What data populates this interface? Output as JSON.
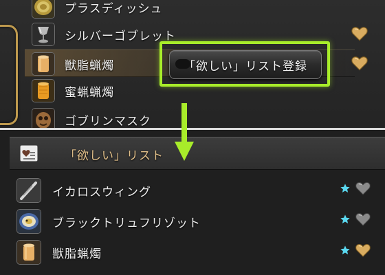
{
  "item_list": [
    {
      "name": "プラスディッシュ",
      "icon": "plate-icon",
      "heart": "none",
      "selected": false
    },
    {
      "name": "シルバーゴブレット",
      "icon": "goblet-icon",
      "heart": "gold",
      "selected": false
    },
    {
      "name": "獣脂蝋燭",
      "icon": "candle-icon",
      "heart": "gold",
      "selected": true
    },
    {
      "name": "蜜蝋蝋燭",
      "icon": "beeswax-candle-icon",
      "heart": "none",
      "selected": false
    },
    {
      "name": "ゴブリンマスク",
      "icon": "goblin-mask-icon",
      "heart": "none",
      "selected": false
    }
  ],
  "context_menu": {
    "register_label": "「欲しい」リスト登録"
  },
  "wishlist": {
    "title": "「欲しい」リスト",
    "items": [
      {
        "name": "イカロスウィング",
        "icon": "icarus-wing-icon",
        "star": "cyan",
        "heart": "gray"
      },
      {
        "name": "ブラックトリュフリゾット",
        "icon": "risotto-icon",
        "star": "cyan",
        "heart": "gray"
      },
      {
        "name": "獣脂蝋燭",
        "icon": "candle-icon",
        "star": "cyan",
        "heart": "gold"
      }
    ]
  },
  "colors": {
    "highlight_green": "#a8ec2a",
    "heart_gold": "#d9ac60",
    "heart_gray": "#8a8a8a",
    "star_cyan": "#5ad8f0",
    "header_text": "#e2c08a"
  }
}
